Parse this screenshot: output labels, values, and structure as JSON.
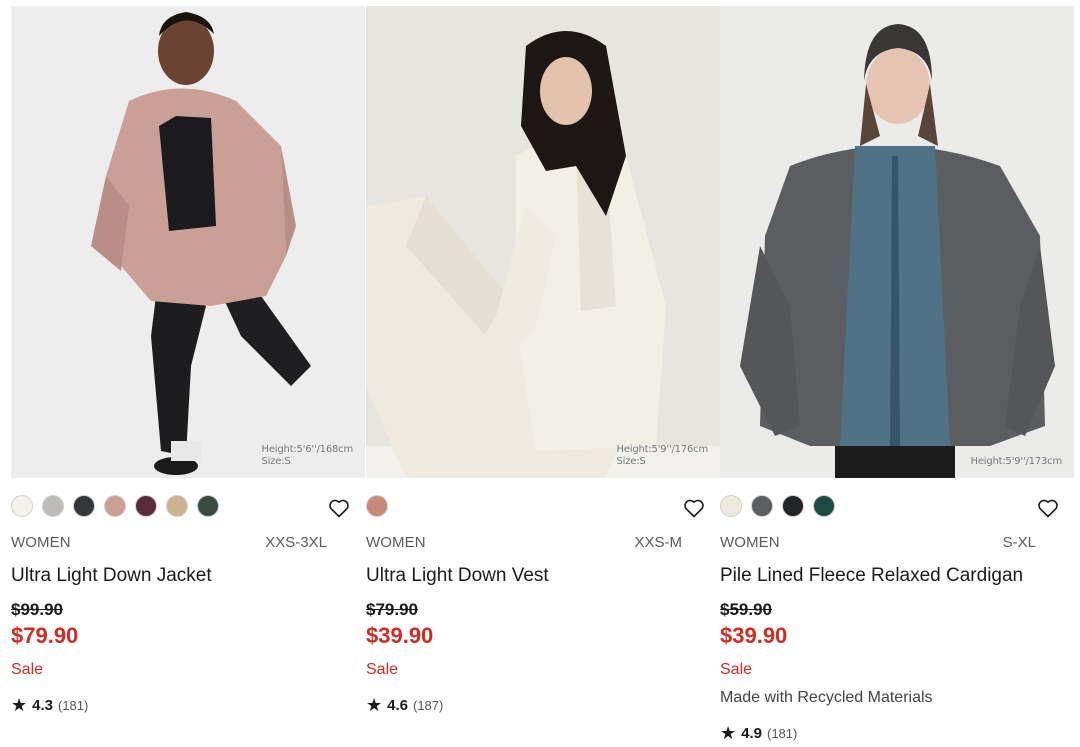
{
  "products": [
    {
      "photo": {
        "height": "Height:5'6''/168cm",
        "size": "Size:S",
        "bg": "#ececec"
      },
      "swatches": [
        "#f4f1ea",
        "#bdbcb8",
        "#34373a",
        "#c99f96",
        "#5a2c3a",
        "#cdb291",
        "#3b4a3e"
      ],
      "gender": "WOMEN",
      "sizes": "XXS-3XL",
      "name": "Ultra Light Down Jacket",
      "old_price": "$99.90",
      "new_price": "$79.90",
      "sale": "Sale",
      "flag": "",
      "rating": {
        "star": "★",
        "score": "4.3",
        "count": "(181)"
      }
    },
    {
      "photo": {
        "height": "Height:5'9''/176cm",
        "size": "Size:S",
        "bg": "#e9e7e2"
      },
      "swatches": [
        "#c98a78"
      ],
      "gender": "WOMEN",
      "sizes": "XXS-M",
      "name": "Ultra Light Down Vest",
      "old_price": "$79.90",
      "new_price": "$39.90",
      "sale": "Sale",
      "flag": "",
      "rating": {
        "star": "★",
        "score": "4.6",
        "count": "(187)"
      }
    },
    {
      "photo": {
        "height": "Height:5'9''/173cm",
        "size": "",
        "bg": "#ebebea"
      },
      "swatches": [
        "#efeadf",
        "#5b5d60",
        "#232426",
        "#1d4a44"
      ],
      "gender": "WOMEN",
      "sizes": "S-XL",
      "name": "Pile Lined Fleece Relaxed Cardigan",
      "old_price": "$59.90",
      "new_price": "$39.90",
      "sale": "Sale",
      "flag": "Made with Recycled Materials",
      "rating": {
        "star": "★",
        "score": "4.9",
        "count": "(181)"
      }
    }
  ],
  "icons": {
    "favorite": "heart-outline-icon",
    "rating": "star-icon"
  },
  "colors": {
    "sale": "#d22b1f",
    "text": "#1b1b1b"
  }
}
